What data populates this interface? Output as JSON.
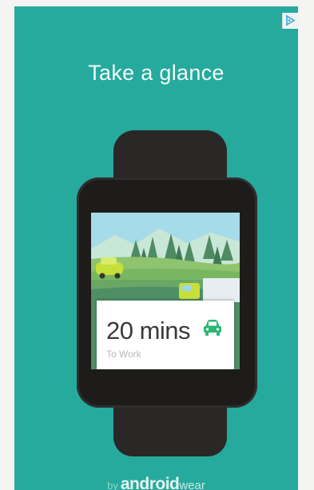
{
  "ad": {
    "headline": "Take a glance",
    "adchoices_icon": "adchoices-triangle-icon",
    "background_color": "#25aa9d"
  },
  "watch": {
    "card": {
      "eta": "20 mins",
      "destination": "To Work",
      "icon": "car-icon",
      "icon_color": "#2bb673"
    }
  },
  "branding": {
    "by": "by",
    "name": "android",
    "suffix": "wear"
  }
}
